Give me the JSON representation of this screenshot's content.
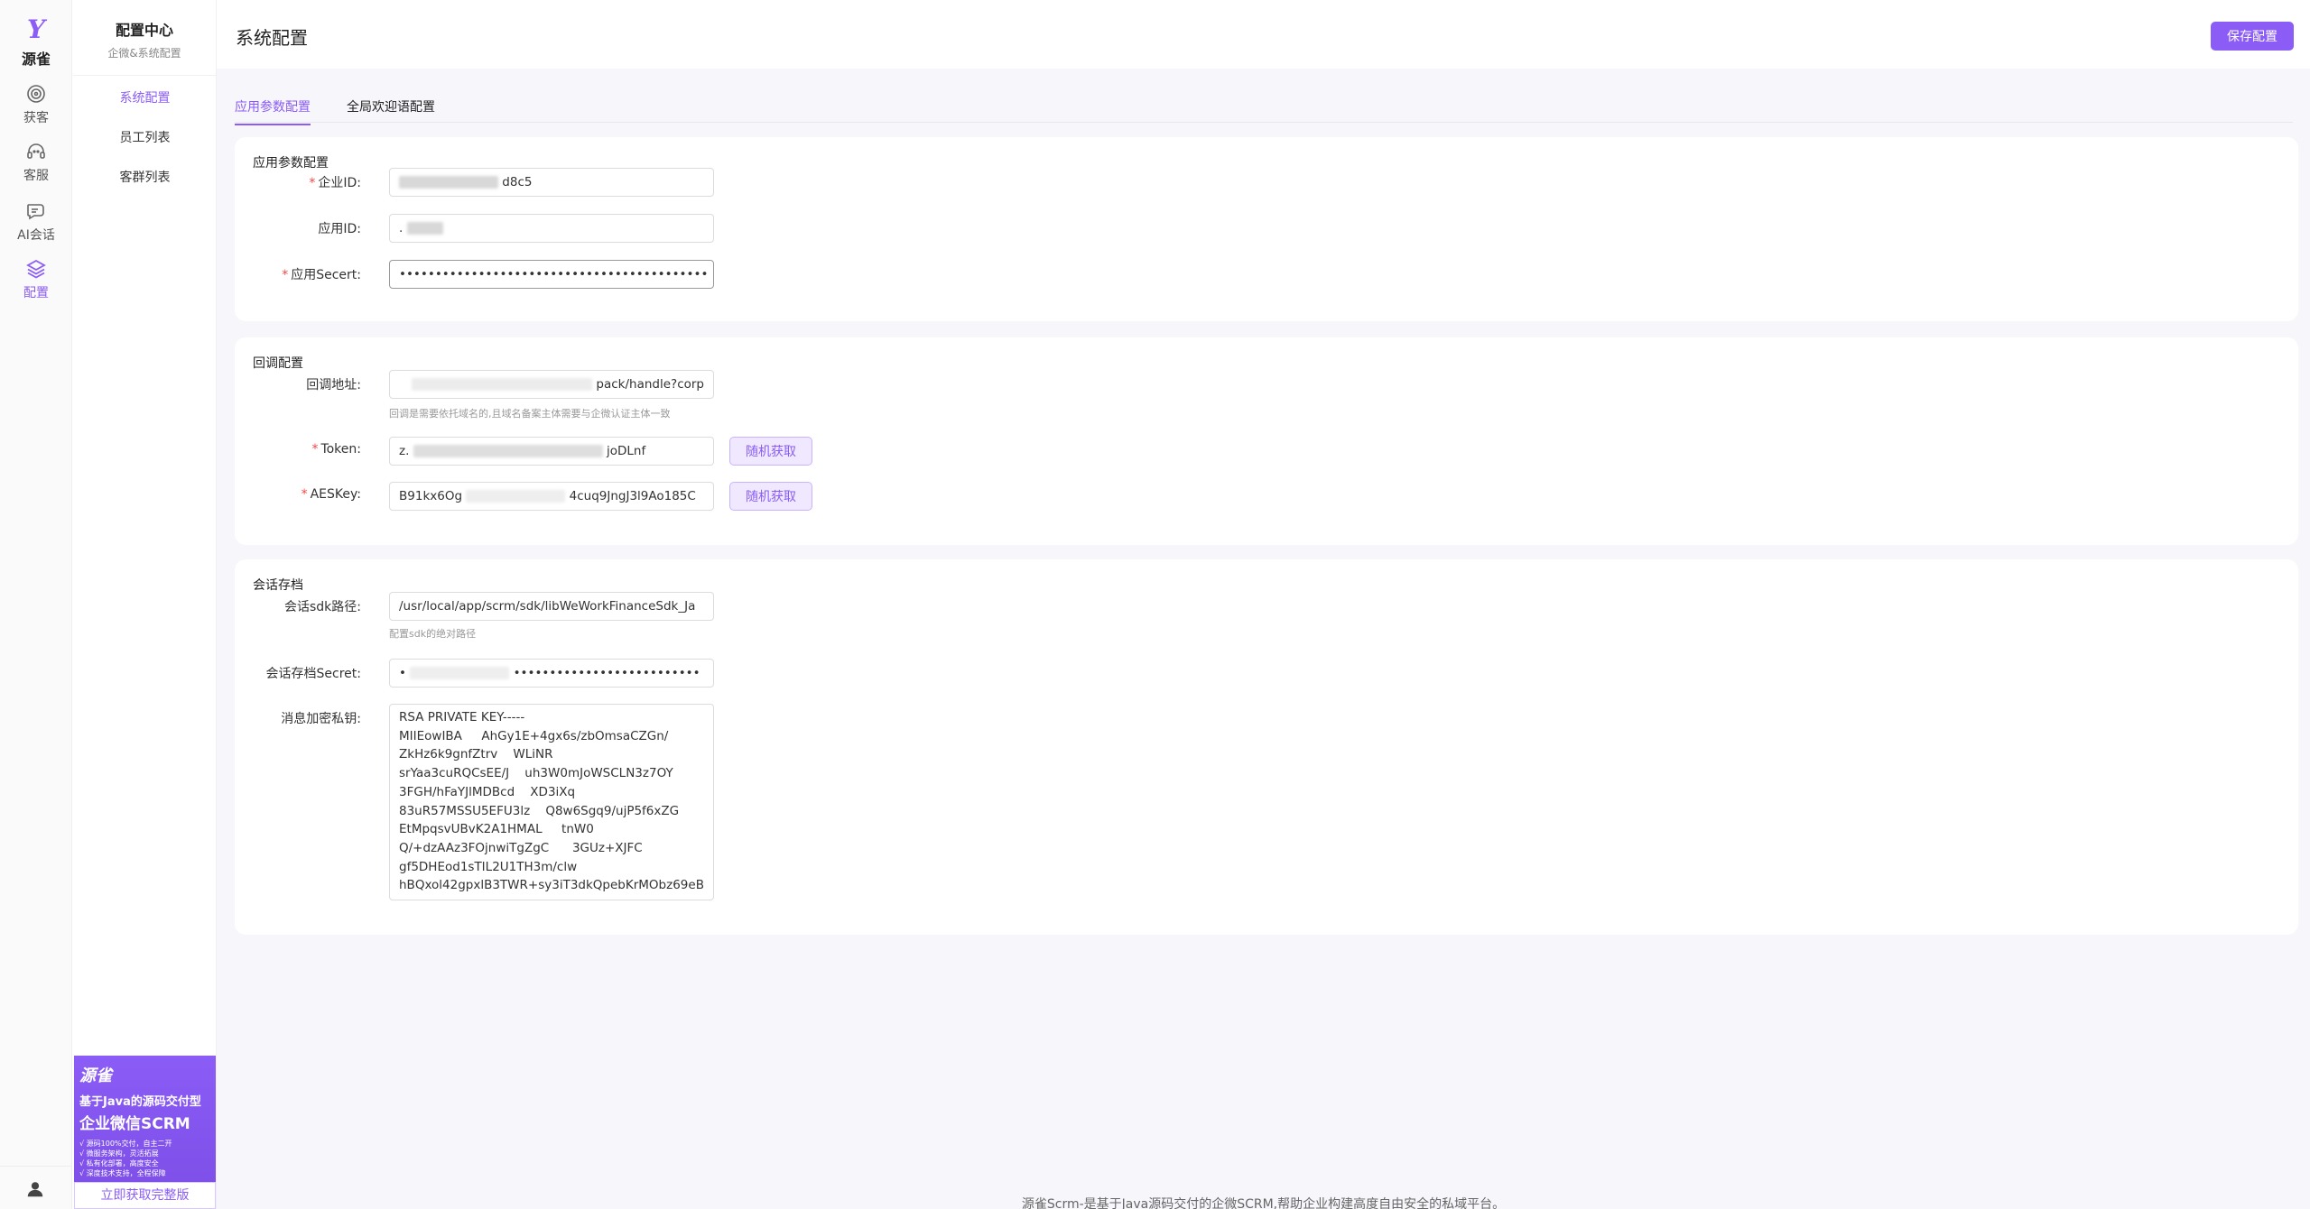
{
  "rail": {
    "logo_mark": "Y",
    "brand": "源雀",
    "items": [
      {
        "label": "获客",
        "icon": "target-icon"
      },
      {
        "label": "客服",
        "icon": "headset-icon"
      },
      {
        "label": "AI会话",
        "icon": "chat-icon"
      },
      {
        "label": "配置",
        "icon": "layers-icon"
      }
    ],
    "user_icon": "user-icon"
  },
  "sidebar": {
    "title": "配置中心",
    "subtitle": "企微&系统配置",
    "items": [
      {
        "label": "系统配置"
      },
      {
        "label": "员工列表"
      },
      {
        "label": "客群列表"
      }
    ],
    "promo": {
      "brand": "源雀",
      "line1": "基于Java的源码交付型",
      "line2": "企业微信SCRM",
      "bullets": [
        "√ 源码100%交付，自主二开",
        "√ 微服务架构，灵活拓展",
        "√ 私有化部署，高度安全",
        "√ 深度技术支持，全程保障"
      ],
      "cta": "立即获取完整版"
    }
  },
  "header": {
    "title": "系统配置",
    "save_label": "保存配置"
  },
  "tabs": [
    {
      "label": "应用参数配置"
    },
    {
      "label": "全局欢迎语配置"
    }
  ],
  "app_params": {
    "title": "应用参数配置",
    "corp_id_label": "企业ID:",
    "corp_id_value": "d8c5",
    "app_id_label": "应用ID:",
    "app_id_value": ".",
    "secret_label": "应用Secert:",
    "secret_value": "•••••••••••••••••••••••••••••••••••••••••••"
  },
  "callback": {
    "title": "回调配置",
    "url_label": "回调地址:",
    "url_value": "pack/handle?corp",
    "url_hint": "回调是需要依托域名的,且域名备案主体需要与企微认证主体一致",
    "token_label": "Token:",
    "token_value_prefix": "z.",
    "token_value_suffix": "joDLnf",
    "aes_label": "AESKey:",
    "aes_value_prefix": "B91kx6Og",
    "aes_value_suffix": "4cuq9JngJ3l9Ao185C",
    "random_label": "随机获取"
  },
  "archive": {
    "title": "会话存档",
    "sdk_label": "会话sdk路径:",
    "sdk_value": "/usr/local/app/scrm/sdk/libWeWorkFinanceSdk_Ja",
    "sdk_hint": "配置sdk的绝对路径",
    "secret_label": "会话存档Secret:",
    "secret_prefix": "•",
    "secret_value": "••••••••••••••••••••••••••",
    "key_label": "消息加密私钥:",
    "key_value": "RSA PRIVATE KEY-----\nMIIEowIBA     AhGy1E+4gx6s/zbOmsaCZGn/\nZkHz6k9gnfZtrv    WLiNR\nsrYaa3cuRQCsEE/J    uh3W0mJoWSCLN3z7OY\n3FGH/hFaYJlMDBcd    XD3iXq\n83uR57MSSU5EFU3lz    Q8w6Sgq9/ujP5f6xZG\nEtMpqsvUBvK2A1HMAL     tnW0\nQ/+dzAAz3FOjnwiTgZgC      3GUz+XJFC\ngf5DHEod1sTIL2U1TH3m/clw\nhBQxol42gpxlB3TWR+sy3iT3dkQpebKrMObz69eB"
  },
  "footer": {
    "text": "源雀Scrm-是基于Java源码交付的企微SCRM,帮助企业构建高度自由安全的私域平台。"
  },
  "colors": {
    "accent": "#8b5cf6",
    "required": "#f04848",
    "page_bg": "#f6f6fb"
  }
}
